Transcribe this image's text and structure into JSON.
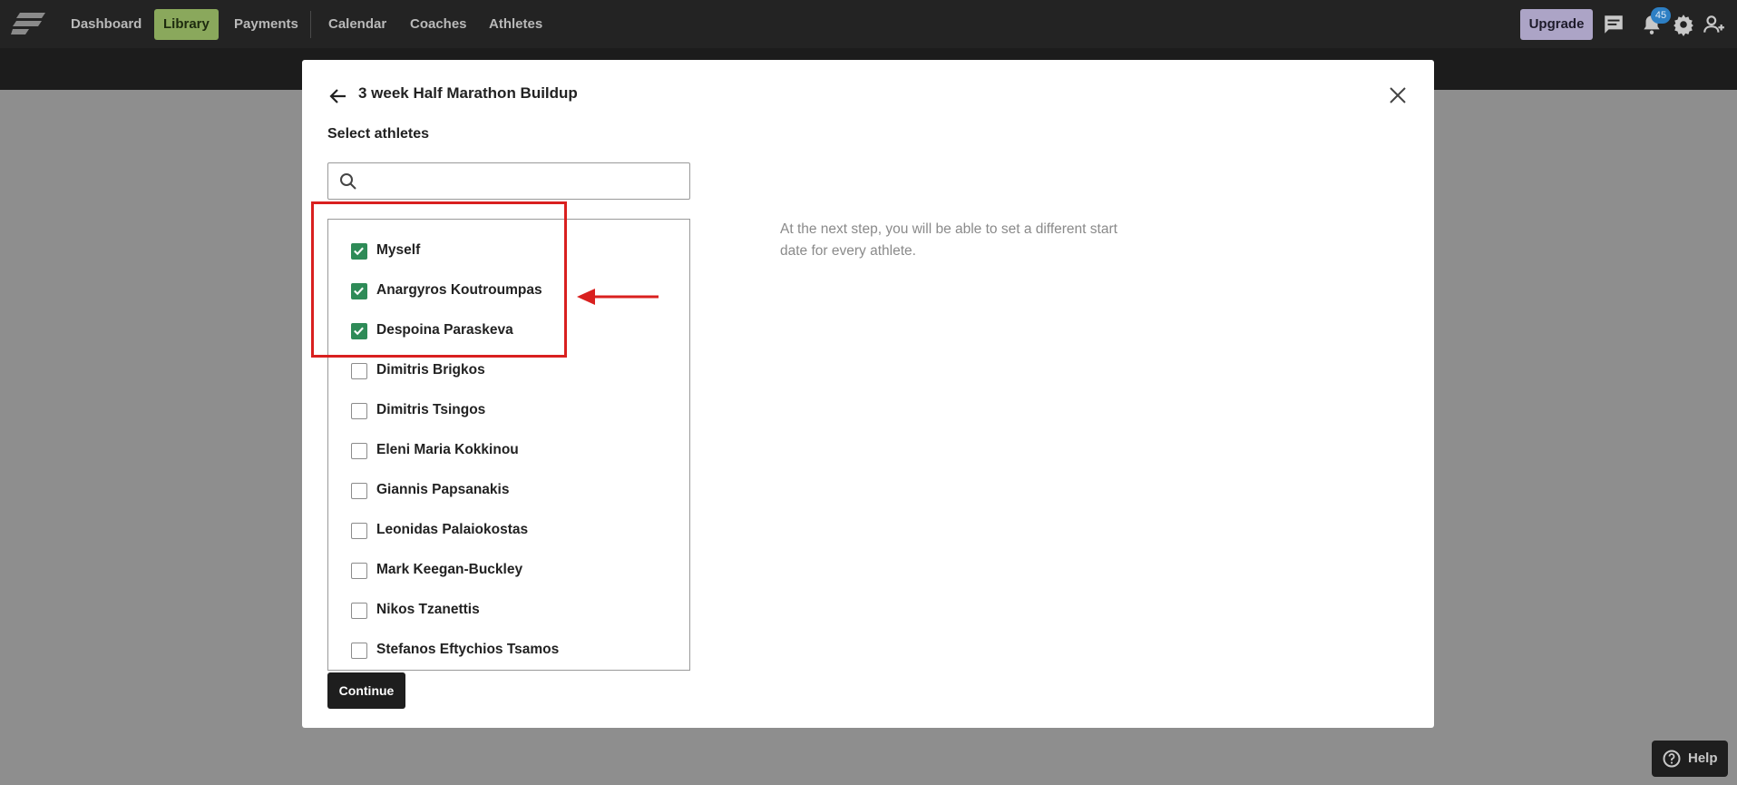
{
  "nav": {
    "items": [
      {
        "label": "Dashboard",
        "active": false
      },
      {
        "label": "Library",
        "active": true
      },
      {
        "label": "Payments",
        "active": false
      },
      {
        "label": "Calendar",
        "active": false
      },
      {
        "label": "Coaches",
        "active": false
      },
      {
        "label": "Athletes",
        "active": false
      }
    ],
    "upgrade_label": "Upgrade",
    "notification_count": "45",
    "icons": [
      "chat-icon",
      "bell-icon",
      "gear-icon",
      "user-add-icon"
    ]
  },
  "modal": {
    "title": "3 week Half Marathon Buildup",
    "section_title": "Select athletes",
    "search": {
      "value": "",
      "placeholder": ""
    },
    "athletes": [
      {
        "name": "Myself",
        "checked": true
      },
      {
        "name": "Anargyros Koutroumpas",
        "checked": true
      },
      {
        "name": "Despoina Paraskeva",
        "checked": true
      },
      {
        "name": "Dimitris Brigkos",
        "checked": false
      },
      {
        "name": "Dimitris Tsingos",
        "checked": false
      },
      {
        "name": "Eleni Maria Kokkinou",
        "checked": false
      },
      {
        "name": "Giannis Papsanakis",
        "checked": false
      },
      {
        "name": "Leonidas Palaiokostas",
        "checked": false
      },
      {
        "name": "Mark Keegan-Buckley",
        "checked": false
      },
      {
        "name": "Nikos Tzanettis",
        "checked": false
      },
      {
        "name": "Stefanos Eftychios Tsamos",
        "checked": false
      }
    ],
    "info_text": "At the next step, you will be able to set a different start date for every athlete.",
    "continue_label": "Continue"
  },
  "help": {
    "label": "Help"
  },
  "colors": {
    "active_nav": "#8aa85c",
    "upgrade": "#aca4c6",
    "checkbox_checked": "#2e8b57",
    "annotation": "#d9201f",
    "badge": "#2d7fc4"
  }
}
